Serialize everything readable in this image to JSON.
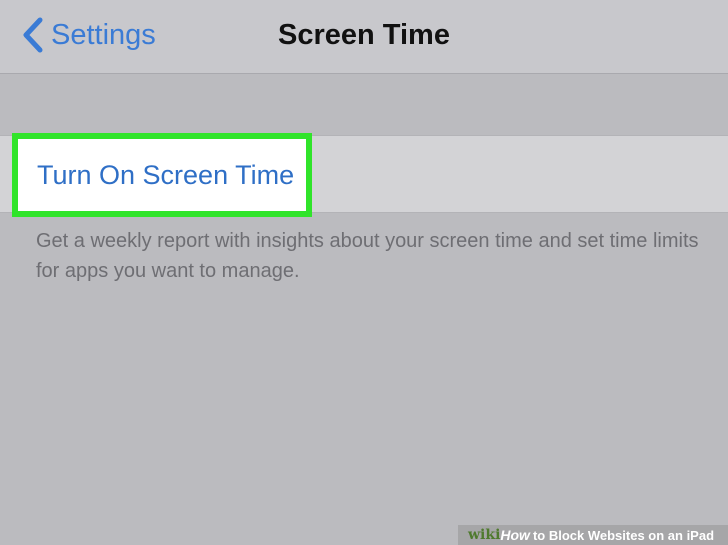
{
  "navbar": {
    "back_label": "Settings",
    "title": "Screen Time",
    "back_icon": "chevron-left-icon"
  },
  "cell": {
    "label": "Turn On Screen Time"
  },
  "footer": {
    "text": "Get a weekly report with insights about your screen time and set time limits for apps you want to manage."
  },
  "watermark": {
    "wiki": "wiki",
    "how": "How",
    "rest": "to Block Websites on an iPad"
  },
  "colors": {
    "accent": "#2f6fc6",
    "highlight": "#30e42a",
    "background": "#bbbbbf"
  }
}
